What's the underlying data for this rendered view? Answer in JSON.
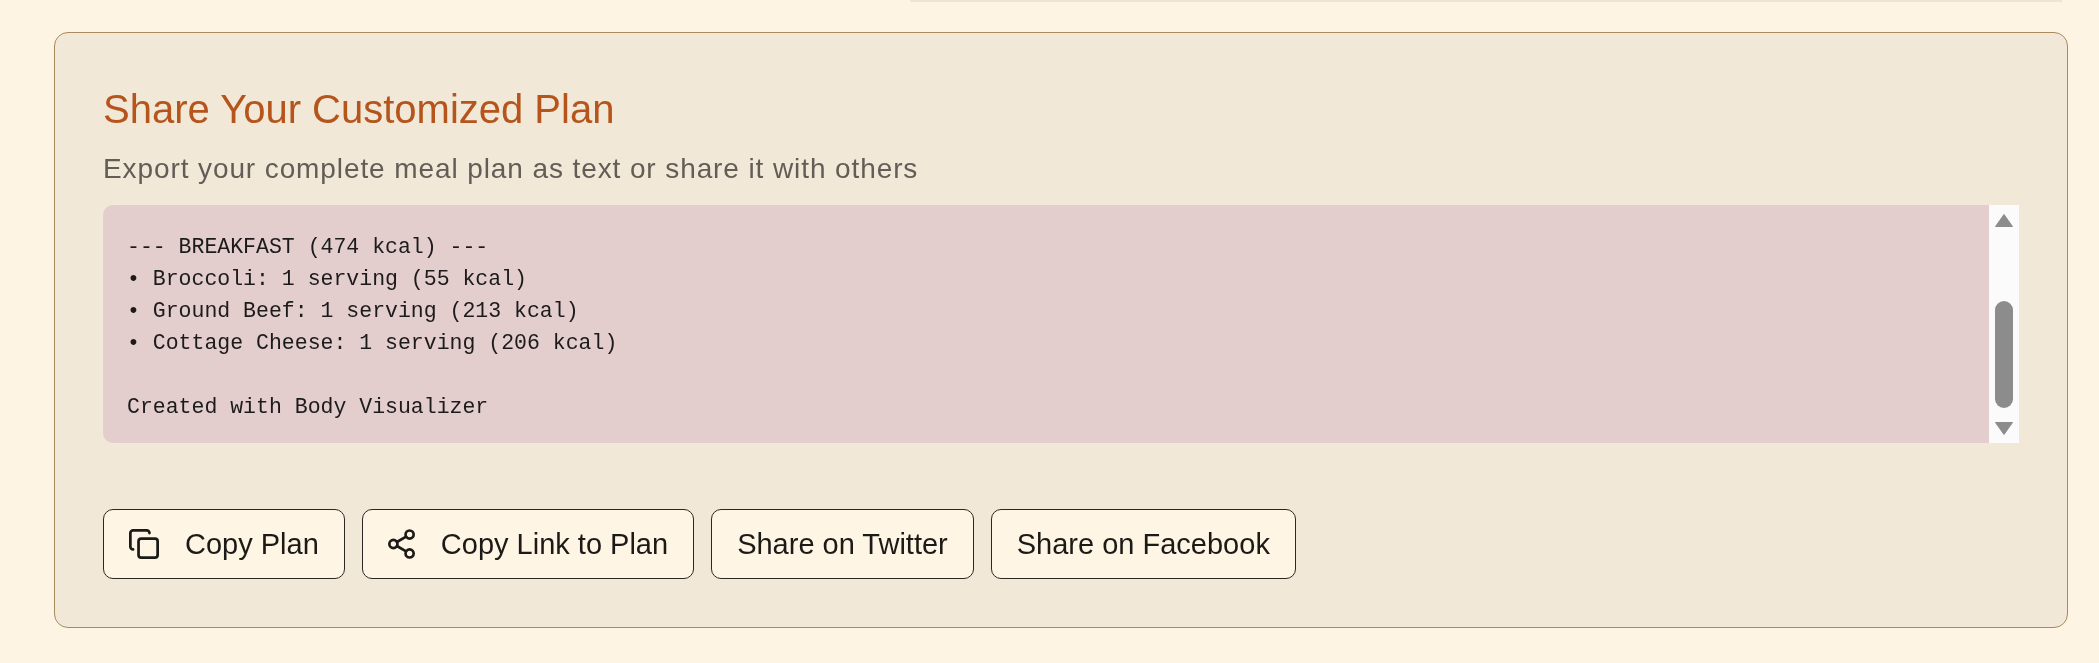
{
  "share_card": {
    "title": "Share Your Customized Plan",
    "subtitle": "Export your complete meal plan as text or share it with others",
    "plan_text": {
      "value": "--- BREAKFAST (474 kcal) ---\n• Broccoli: 1 serving (55 kcal)\n• Ground Beef: 1 serving (213 kcal)\n• Cottage Cheese: 1 serving (206 kcal)\n\nCreated with Body Visualizer"
    },
    "buttons": [
      {
        "label": "Copy Plan",
        "kind": "copy"
      },
      {
        "label": "Copy Link to Plan",
        "kind": "link"
      },
      {
        "label": "Share on Twitter",
        "kind": "plain"
      },
      {
        "label": "Share on Facebook",
        "kind": "plain"
      }
    ]
  }
}
